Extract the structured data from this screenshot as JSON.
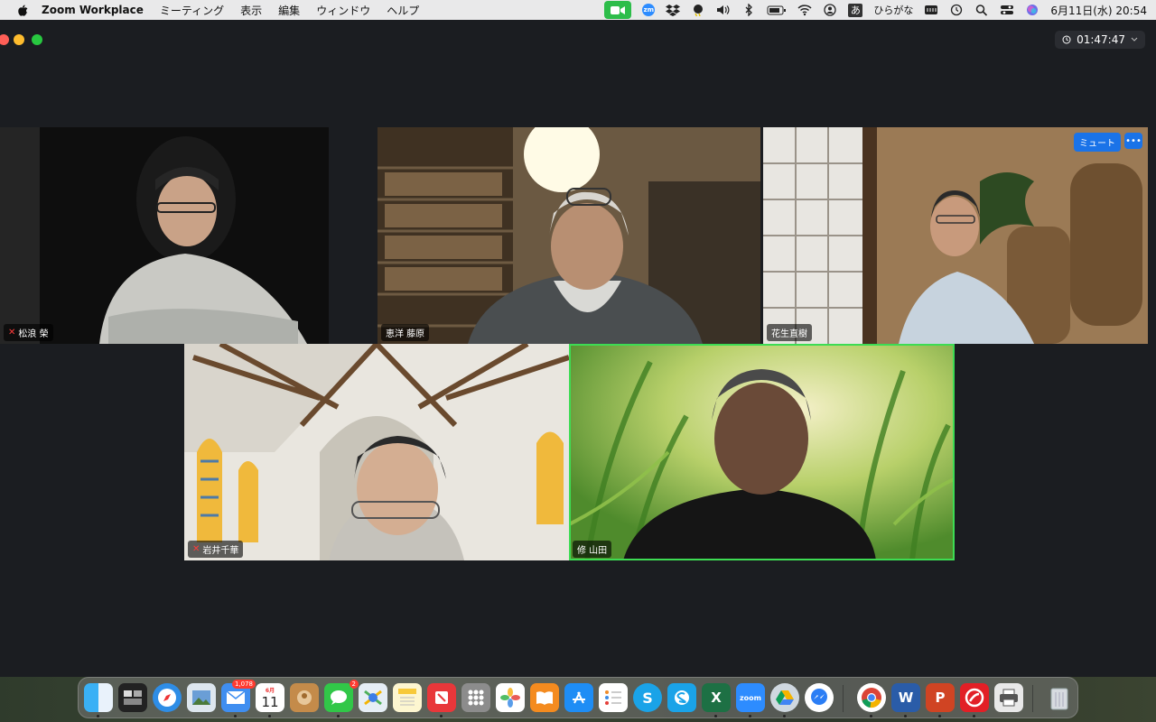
{
  "menubar": {
    "app_name": "Zoom Workplace",
    "menus": [
      "ミーティング",
      "表示",
      "編集",
      "ウィンドウ",
      "ヘルプ"
    ],
    "ime_glyph": "あ",
    "ime_label": "ひらがな",
    "zoom_label": "zm",
    "datetime": "6月11日(水)  20:54"
  },
  "window": {
    "timer": "01:47:47",
    "participants": [
      {
        "name": "松浪 榮",
        "muted": true
      },
      {
        "name": "恵洋 藤原",
        "muted": false
      },
      {
        "name": "花生直樹",
        "muted": false
      },
      {
        "name": "岩井千華",
        "muted": true
      },
      {
        "name": "修 山田",
        "muted": false,
        "active_speaker": true
      }
    ],
    "hover_controls": {
      "mute_label": "ミュート",
      "more_label": "•••"
    }
  },
  "dock": {
    "mail_badge": "1,078",
    "messages_badge": "2",
    "calendar_month": "6月",
    "calendar_day": "11",
    "zoom_label": "zoom",
    "word_label": "W",
    "excel_label": "X",
    "powerpoint_label": "P",
    "skype_label": "S"
  }
}
